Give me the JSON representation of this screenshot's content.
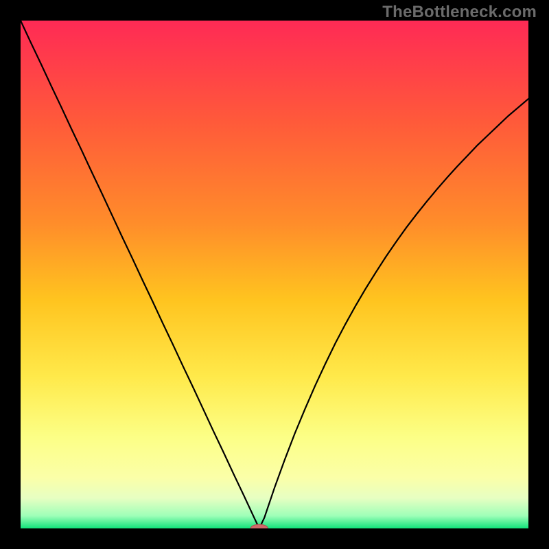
{
  "watermark": {
    "text": "TheBottleneck.com"
  },
  "colors": {
    "black": "#000000",
    "line": "#000000",
    "marker_fill": "#d06a6a",
    "marker_stroke": "#b24f4f",
    "gradient_stops": [
      {
        "pct": 0,
        "color": "#ff2a55"
      },
      {
        "pct": 20,
        "color": "#ff5a3a"
      },
      {
        "pct": 40,
        "color": "#ff8d2a"
      },
      {
        "pct": 55,
        "color": "#ffc41f"
      },
      {
        "pct": 70,
        "color": "#ffe94a"
      },
      {
        "pct": 82,
        "color": "#fcff86"
      },
      {
        "pct": 90,
        "color": "#fbffa8"
      },
      {
        "pct": 94,
        "color": "#e7ffc2"
      },
      {
        "pct": 97.5,
        "color": "#9fffb8"
      },
      {
        "pct": 100,
        "color": "#11e27b"
      }
    ]
  },
  "chart_data": {
    "type": "line",
    "title": "",
    "xlabel": "",
    "ylabel": "",
    "xlim": [
      0,
      100
    ],
    "ylim": [
      0,
      100
    ],
    "x": [
      0,
      2,
      4,
      6,
      8,
      10,
      12,
      14,
      16,
      18,
      20,
      22,
      24,
      26,
      28,
      30,
      32,
      34,
      36,
      38,
      40,
      42,
      44,
      46,
      47,
      48,
      50,
      52,
      54,
      56,
      58,
      60,
      62,
      64,
      66,
      68,
      70,
      72,
      74,
      76,
      78,
      80,
      82,
      84,
      86,
      88,
      90,
      92,
      94,
      96,
      98,
      100
    ],
    "values": [
      100,
      95.7,
      91.5,
      87.2,
      83,
      78.7,
      74.5,
      70.2,
      66,
      61.7,
      57.4,
      53.2,
      48.9,
      44.7,
      40.4,
      36.2,
      31.9,
      27.7,
      23.4,
      19.1,
      14.9,
      10.6,
      6.4,
      2.1,
      0,
      2.1,
      8,
      13.5,
      18.7,
      23.5,
      28.1,
      32.4,
      36.5,
      40.3,
      43.9,
      47.3,
      50.5,
      53.6,
      56.5,
      59.3,
      61.9,
      64.4,
      66.8,
      69.1,
      71.3,
      73.4,
      75.5,
      77.4,
      79.3,
      81.2,
      82.9,
      84.6
    ],
    "marker": {
      "x": 47,
      "y": 0,
      "rx": 1.7,
      "ry": 0.8
    },
    "annotations": []
  }
}
